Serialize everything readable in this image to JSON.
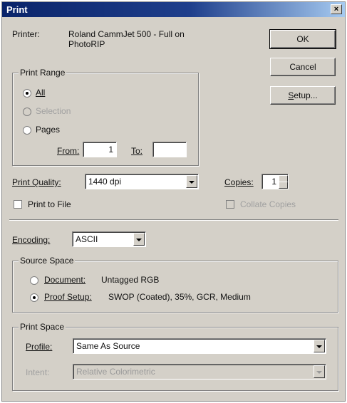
{
  "window": {
    "title": "Print",
    "close_glyph": "×"
  },
  "printer": {
    "label": "Printer:",
    "name_line1": "Roland CammJet 500 - Full on",
    "name_line2": "PhotoRIP"
  },
  "buttons": {
    "ok": "OK",
    "cancel": "Cancel",
    "setup": "Setup..."
  },
  "print_range": {
    "legend": "Print Range",
    "all": "All",
    "selection": "Selection",
    "pages": "Pages",
    "from_label": "From:",
    "from_value": "1",
    "to_label": "To:",
    "to_value": "",
    "selected": "all"
  },
  "print_quality": {
    "label": "Print Quality:",
    "value": "1440 dpi"
  },
  "copies": {
    "label": "Copies:",
    "value": "1"
  },
  "print_to_file": {
    "label": "Print to File",
    "checked": false
  },
  "collate": {
    "label": "Collate Copies",
    "enabled": false
  },
  "encoding": {
    "label": "Encoding:",
    "value": "ASCII"
  },
  "source_space": {
    "legend": "Source Space",
    "document_label": "Document:",
    "document_value": "Untagged RGB",
    "proof_label": "Proof Setup:",
    "proof_value": "SWOP (Coated), 35%, GCR, Medium",
    "selected": "proof"
  },
  "print_space": {
    "legend": "Print Space",
    "profile_label": "Profile:",
    "profile_value": "Same As Source",
    "intent_label": "Intent:",
    "intent_value": "Relative Colorimetric"
  },
  "colors": {
    "titlebar": "#0a246a",
    "face": "#d4d0c8",
    "disabled_text": "#a0a0a0"
  },
  "icons": {
    "close": "close-icon",
    "dropdown": "chevron-down-icon",
    "spin": "spinner-arrows-icon"
  }
}
